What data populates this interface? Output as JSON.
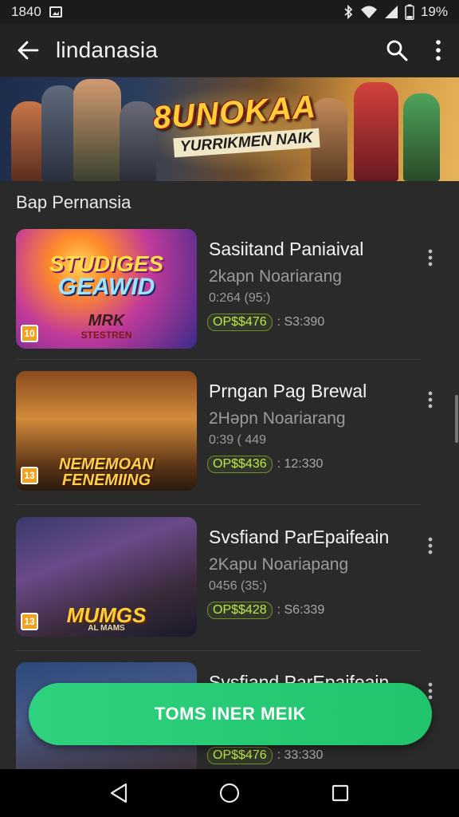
{
  "status_bar": {
    "time": "1840",
    "battery": "19%"
  },
  "app_bar": {
    "title": "lindanasia"
  },
  "banner": {
    "title": "8UNOKAA",
    "subtitle": "YURRIKMEN NAIK"
  },
  "section": {
    "title": "Bap Pernansia"
  },
  "games": [
    {
      "thumb_title": "STUDIGES",
      "thumb_title2": "GEAWID",
      "thumb_sub": "MRK",
      "thumb_sub2": "STESTREN",
      "age": "10",
      "title": "Sasiitand Paniaival",
      "subtitle": "2kapn Noariarang",
      "meta": "0:264 (95:)",
      "price": "OP$$476",
      "time": ": S3:390"
    },
    {
      "thumb_title": "NEMEMOAN",
      "thumb_title2": "FENEMIING",
      "age": "13",
      "title": "Prngan Pag Brewal",
      "subtitle": "2Həpn Noariarang",
      "meta": "0:39 ( 449",
      "price": "OP$$436",
      "time": ": 12:330"
    },
    {
      "thumb_title": "MUMGS",
      "thumb_title2": "AL MAMS",
      "age": "13",
      "title": "Svsfiand ParEpaifeain",
      "subtitle": "2Kapu Noariapang",
      "meta": "0456 (35:)",
      "price": "OP$$428",
      "time": ": S6:339"
    },
    {
      "title": "Svsfiand ParEpaifeain",
      "price": "OP$$476",
      "time": ": 33:330"
    }
  ],
  "fab": {
    "label": "TOMS INER MEIK"
  },
  "icons": {
    "back": "arrow-left-icon",
    "search": "search-icon",
    "more": "more-vert-icon",
    "bluetooth": "bluetooth-icon",
    "wifi": "wifi-icon",
    "signal": "signal-icon",
    "battery": "battery-icon"
  },
  "colors": {
    "accent": "#2ed27e",
    "price": "#b9e84a",
    "background": "#2a2a2a"
  }
}
